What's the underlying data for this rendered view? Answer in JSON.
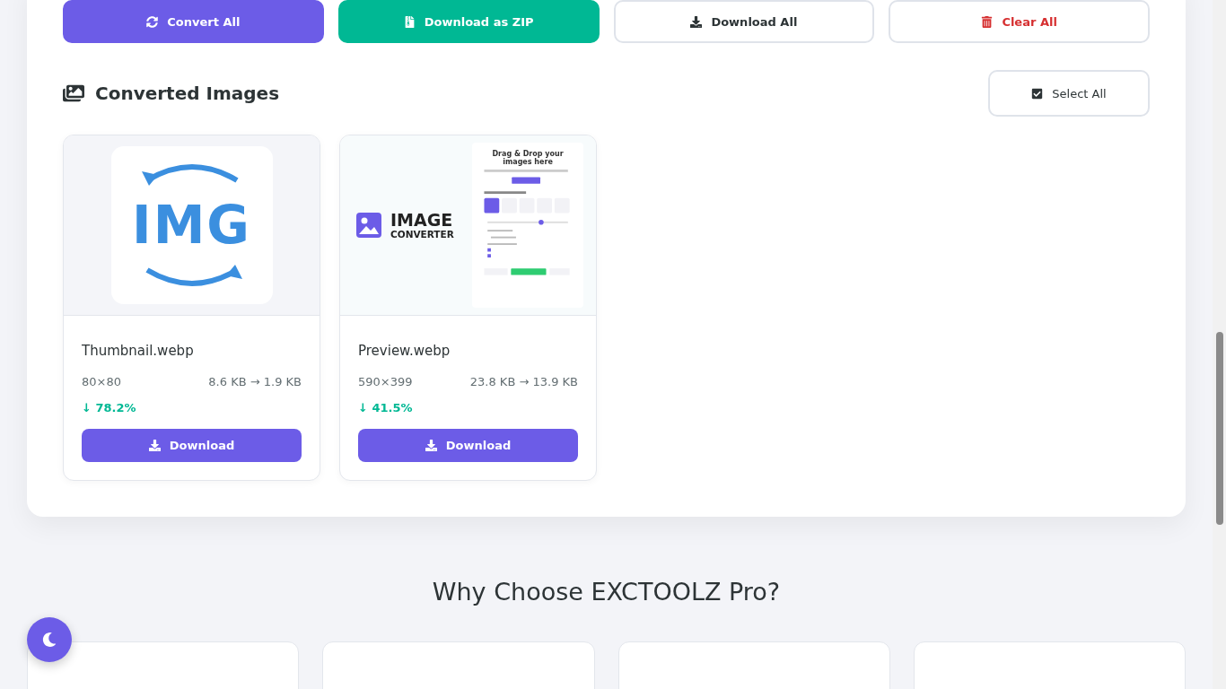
{
  "actions": [
    {
      "kind": "convert",
      "label": "Convert All"
    },
    {
      "kind": "zip",
      "label": "Download as ZIP"
    },
    {
      "kind": "download",
      "label": "Download All"
    },
    {
      "kind": "clear",
      "label": "Clear All"
    }
  ],
  "converted": {
    "title": "Converted Images",
    "select_all": "Select All",
    "items": [
      {
        "kind": "logo",
        "name": "Thumbnail.webp",
        "dimensions": "80×80",
        "sizes": "8.6 KB → 1.9 KB",
        "savings": "↓ 78.2%",
        "button": "Download",
        "logo_text": "IMG"
      },
      {
        "kind": "screenshot",
        "name": "Preview.webp",
        "dimensions": "590×399",
        "sizes": "23.8 KB → 13.9 KB",
        "savings": "↓ 41.5%",
        "button": "Download",
        "logo_top": "IMAGE",
        "logo_bottom": "CONVERTER",
        "heading": "Drag & Drop your images here"
      }
    ]
  },
  "features": {
    "title": "Why Choose EXCTOOLZ Pro?"
  }
}
